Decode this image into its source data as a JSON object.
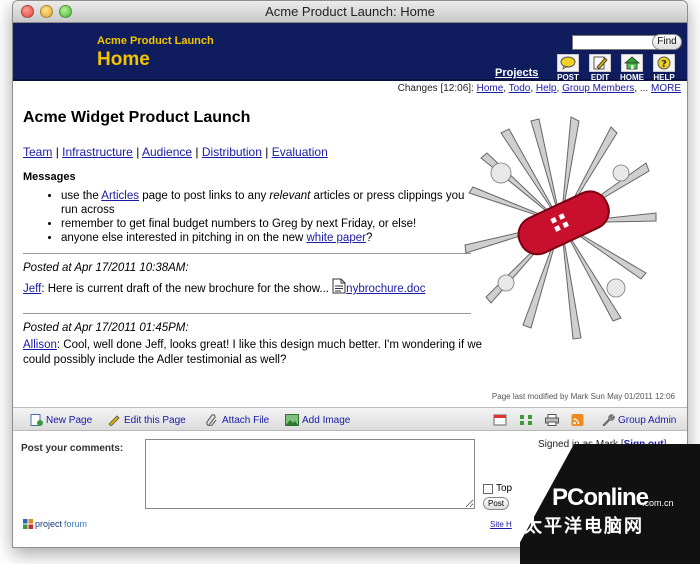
{
  "window": {
    "title": "Acme Product Launch: Home"
  },
  "banner": {
    "project_name": "Acme Product Launch",
    "page_name": "Home",
    "search_value": "",
    "find_label": "Find",
    "projects_link": "Projects",
    "tools": [
      {
        "label": "POST",
        "icon": "post-icon"
      },
      {
        "label": "EDIT",
        "icon": "edit-icon"
      },
      {
        "label": "HOME",
        "icon": "home-icon"
      },
      {
        "label": "HELP",
        "icon": "help-icon"
      }
    ]
  },
  "changes": {
    "prefix": "Changes [12:06]:",
    "links": [
      "Home",
      "Todo",
      "Help",
      "Group Members",
      "MORE"
    ],
    "ellipsis": "..."
  },
  "content": {
    "heading": "Acme Widget Product Launch",
    "tabs": [
      "Team",
      "Infrastructure",
      "Audience",
      "Distribution",
      "Evaluation"
    ],
    "tab_sep": "|",
    "messages_heading": "Messages",
    "bullets": {
      "b1_pre": "use the ",
      "b1_link": "Articles",
      "b1_mid": " page to post links to any ",
      "b1_em": "relevant",
      "b1_post": " articles or press clippings you run across",
      "b2": "remember to get final budget numbers to Greg by next Friday, or else!",
      "b3_pre": "anyone else interested in pitching in on the new ",
      "b3_link": "white paper",
      "b3_post": "?"
    },
    "posts": [
      {
        "posted": "Posted at Apr 17/2011 10:38AM:",
        "author": "Jeff",
        "text": ": Here is current draft of the new brochure for the show...",
        "attachment": "nybrochure.doc"
      },
      {
        "posted": "Posted at Apr 17/2011 01:45PM:",
        "author": "Allison",
        "text": ": Cool, well done Jeff, looks great! I like this design much better. I'm wondering if we could possibly include the Adler testimonial as well?"
      }
    ],
    "last_modified": "Page last modified by Mark Sun May 01/2011 12:06"
  },
  "bottombar": {
    "new_page": "New Page",
    "edit_page": "Edit this Page",
    "attach_file": "Attach File",
    "add_image": "Add Image",
    "group_admin": "Group Admin"
  },
  "comments": {
    "label": "Post your comments:",
    "signed_in": "Signed in as Mark [",
    "sign_out": "Sign out",
    "signed_close": "]",
    "top_label": "Top",
    "post_label": "Post",
    "logo_a": "project",
    "logo_b": "forum",
    "site_link": "Site H"
  },
  "watermark": {
    "main": "PConline",
    "com": ".com.cn",
    "cn": "太平洋电脑网"
  },
  "colors": {
    "banner_bg": "#0f1d5e",
    "banner_text": "#f2c500",
    "link": "#1a1aa6"
  }
}
